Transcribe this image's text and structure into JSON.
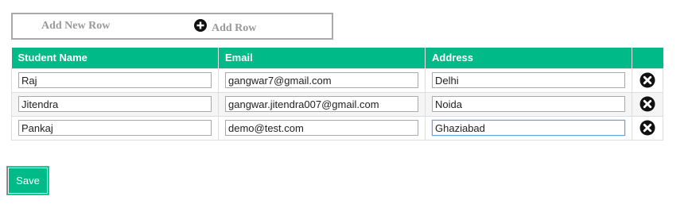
{
  "toolbar": {
    "title": "Add New Row",
    "add_row_label": "Add Row",
    "add_row_icon": "plus-circle-icon"
  },
  "table": {
    "headers": [
      "Student Name",
      "Email",
      "Address",
      ""
    ],
    "rows": [
      {
        "name": "Raj",
        "email": "gangwar7@gmail.com",
        "address": "Delhi"
      },
      {
        "name": "Jitendra",
        "email": "gangwar.jitendra007@gmail.com",
        "address": "Noida"
      },
      {
        "name": "Pankaj",
        "email": "demo@test.com",
        "address": "Ghaziabad"
      }
    ],
    "delete_icon": "close-circle-icon"
  },
  "save_label": "Save",
  "colors": {
    "accent": "#00bb88",
    "header_text": "#ffffff",
    "muted_text": "#999999"
  }
}
